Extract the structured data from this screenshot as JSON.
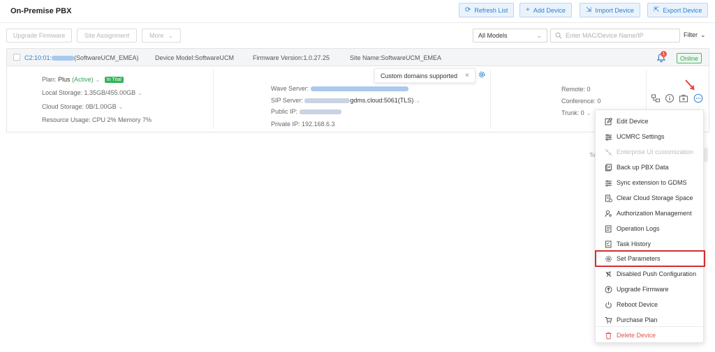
{
  "header": {
    "title": "On-Premise PBX",
    "buttons": {
      "refresh": "Refresh List",
      "add": "Add Device",
      "import": "Import Device",
      "export": "Export Device"
    }
  },
  "toolbar": {
    "upgrade": "Upgrade Firmware",
    "site": "Site Assignment",
    "more": "More",
    "models_value": "All Models",
    "search_placeholder": "Enter MAC/Device Name/IP",
    "filter": "Filter"
  },
  "device": {
    "mac_prefix": "C2:10:01:",
    "mac_suffix": "(SoftwareUCM_EMEA)",
    "model": "Device Model:SoftwareUCM",
    "firmware": "Firmware Version:1.0.27.25",
    "site": "Site Name:SoftwareUCM_EMEA",
    "alert_count": "1",
    "status": "Online",
    "plan_label": "Plan:",
    "plan_value": "Plus",
    "plan_state": "(Active)",
    "trial_badge": "In Trial",
    "local_storage": "Local Storage: 1.35GB/455.00GB",
    "cloud_storage": "Cloud Storage: 0B/1.00GB",
    "resource_usage": "Resource Usage: CPU 2%   Memory 7%",
    "wave_server": "Wave Server:",
    "sip_server_label": "SIP Server:",
    "sip_server_value": "gdms.cloud:5061(TLS)",
    "public_ip": "Public IP:",
    "private_ip": "Private IP: 192.168.6.3",
    "remote": "Remote: 0",
    "conference": "Conference: 0",
    "trunk": "Trunk: 0"
  },
  "tooltip": {
    "text": "Custom domains supported"
  },
  "menu": {
    "items": [
      {
        "label": "Edit Device",
        "icon": "edit-icon"
      },
      {
        "label": "UCMRC Settings",
        "icon": "sliders-icon"
      },
      {
        "label": "Enterprise UI customization",
        "icon": "ui-custom-icon"
      },
      {
        "label": "Back up PBX Data",
        "icon": "backup-icon"
      },
      {
        "label": "Sync extension to GDMS",
        "icon": "sync-icon"
      },
      {
        "label": "Clear Cloud Storage Space",
        "icon": "clear-storage-icon"
      },
      {
        "label": "Authorization Management",
        "icon": "user-key-icon"
      },
      {
        "label": "Operation Logs",
        "icon": "logs-icon"
      },
      {
        "label": "Task History",
        "icon": "history-icon"
      },
      {
        "label": "Set Parameters",
        "icon": "gear-icon"
      },
      {
        "label": "Disabled Push Configuration",
        "icon": "push-off-icon"
      },
      {
        "label": "Upgrade Firmware",
        "icon": "upgrade-icon"
      },
      {
        "label": "Reboot Device",
        "icon": "power-icon"
      },
      {
        "label": "Purchase Plan",
        "icon": "cart-icon"
      },
      {
        "label": "Delete Device",
        "icon": "trash-icon"
      }
    ]
  },
  "ghost_text": "To",
  "colors": {
    "accent": "#2f80d0",
    "online": "#3aa157",
    "danger": "#e0534a",
    "highlight": "#d32f2f"
  }
}
